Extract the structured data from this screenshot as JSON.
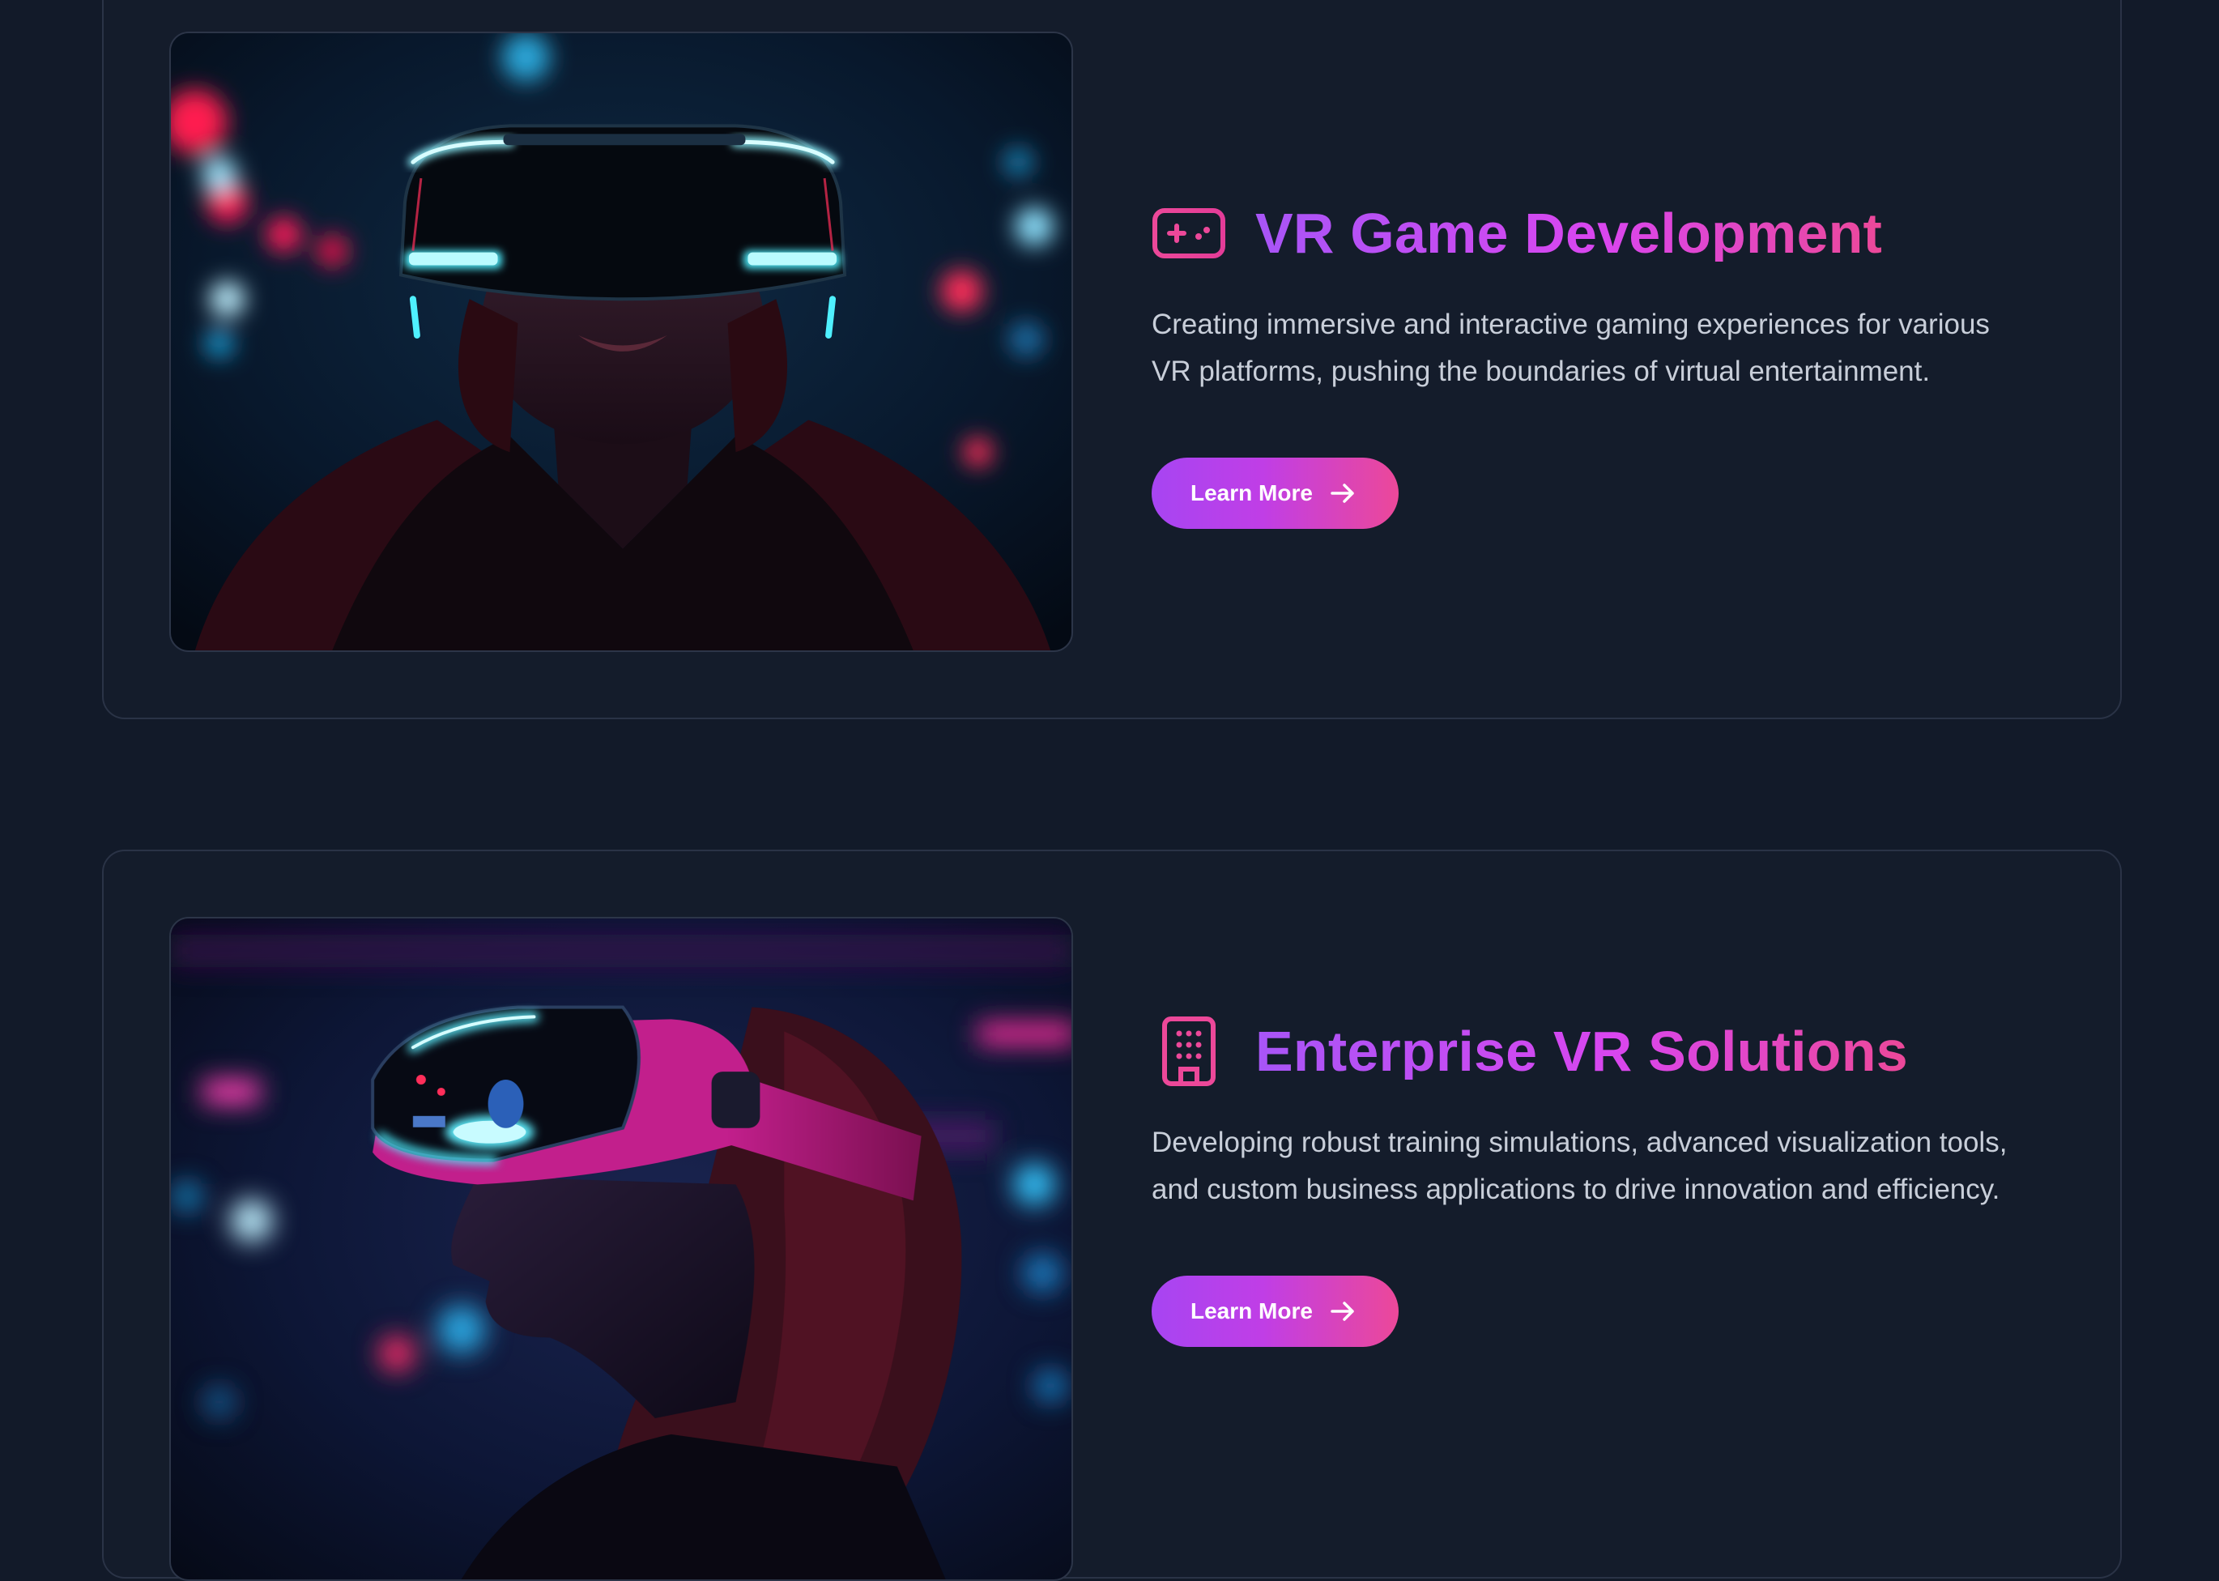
{
  "services": [
    {
      "title": "VR Game Development",
      "description": "Creating immersive and interactive gaming experiences for various VR platforms, pushing the boundaries of virtual entertainment.",
      "button_label": "Learn More",
      "icon": "gamepad-icon",
      "image": "person-wearing-vr-headset-neon-cyan"
    },
    {
      "title": "Enterprise VR Solutions",
      "description": "Developing robust training simulations, advanced visualization tools, and custom business applications to drive innovation and efficiency.",
      "button_label": "Learn More",
      "icon": "building-icon",
      "image": "person-wearing-vr-headset-neon-magenta"
    }
  ],
  "colors": {
    "background": "#121a29",
    "card": "#141c2b",
    "accent_purple": "#a855f7",
    "accent_pink": "#ec4899",
    "text_muted": "#c8ced9"
  }
}
